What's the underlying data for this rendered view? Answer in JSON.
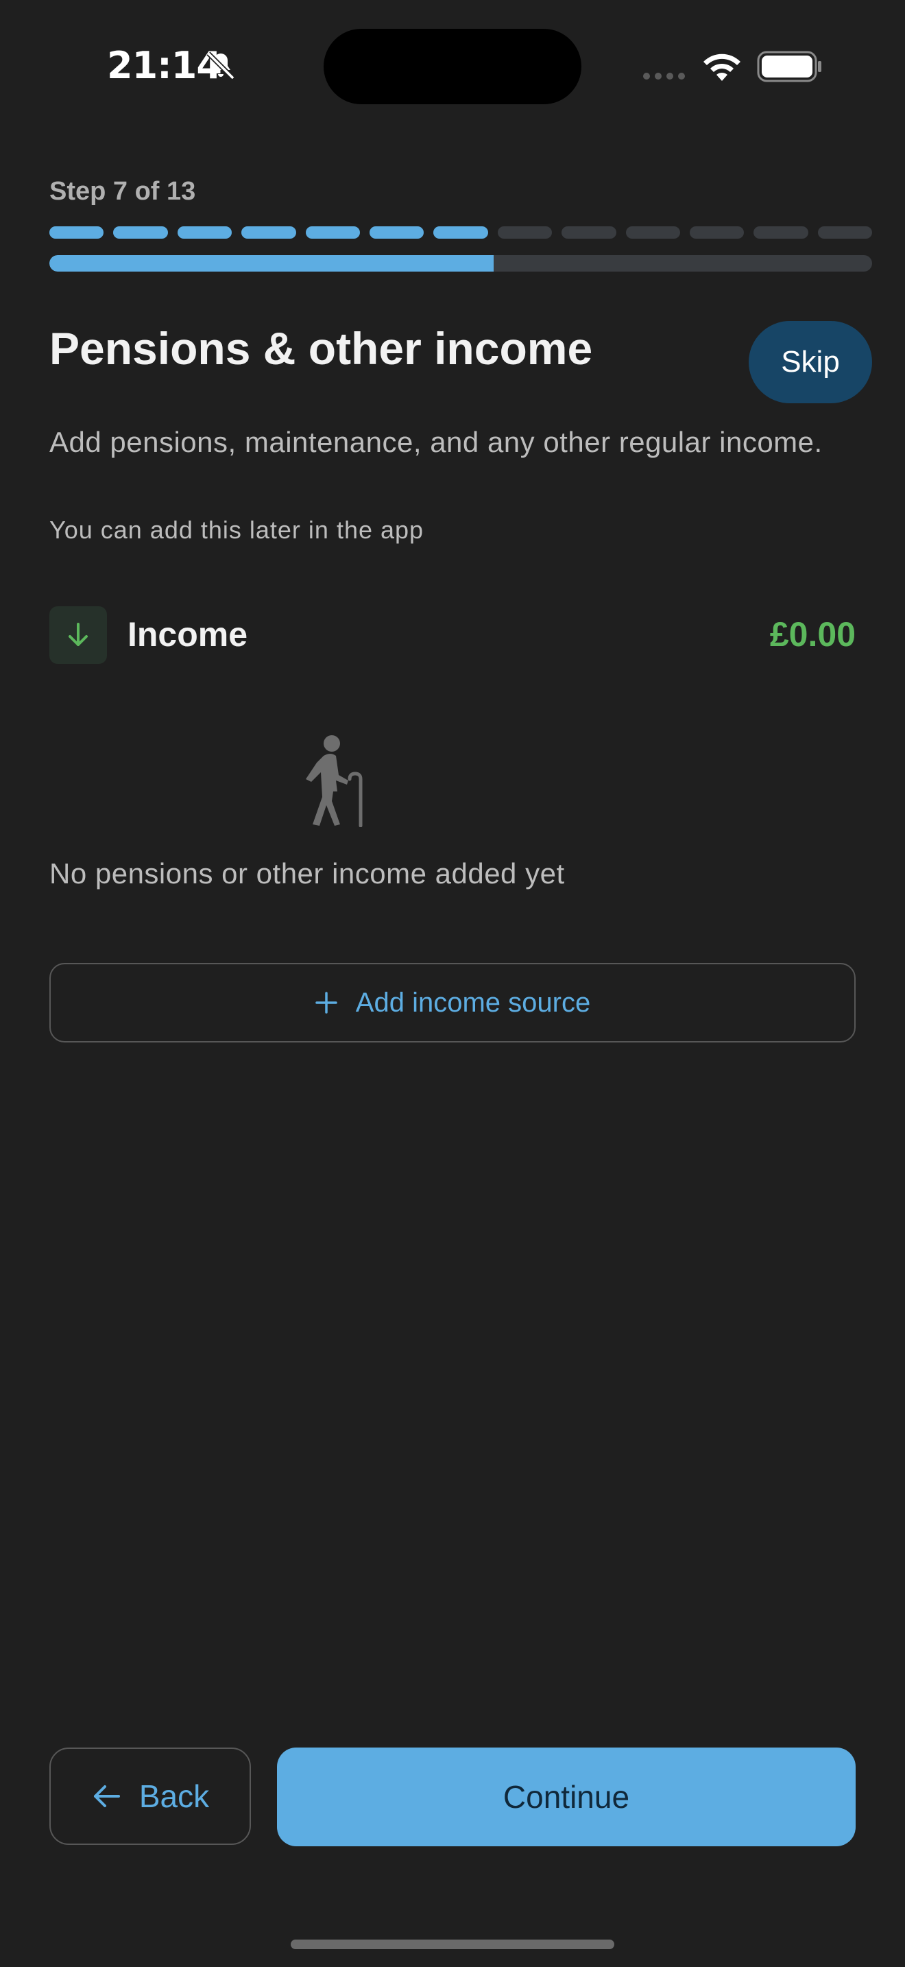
{
  "status_bar": {
    "time": "21:14",
    "icons": [
      "bell-slash-icon",
      "signal-icon",
      "wifi-icon",
      "battery-icon"
    ]
  },
  "progress": {
    "step_label": "Step 7 of 13",
    "current_step": 7,
    "total_steps": 13,
    "completed_fraction": 0.54
  },
  "header": {
    "title": "Pensions & other income",
    "skip_label": "Skip"
  },
  "description": "Add pensions, maintenance, and any other regular income.",
  "hint": "You can add this later in the app",
  "income": {
    "label": "Income",
    "total": "£0.00",
    "icon": "arrow-down-icon"
  },
  "empty_state": {
    "icon": "elderly-person-icon",
    "message": "No pensions or other income added yet"
  },
  "add_source": {
    "label": "Add income source",
    "icon": "plus-icon"
  },
  "footer": {
    "back_label": "Back",
    "continue_label": "Continue"
  },
  "colors": {
    "background": "#1f1f1f",
    "accent": "#5dade2",
    "income_green": "#5cb85c",
    "skip_background": "#174566",
    "track": "#393c40"
  }
}
